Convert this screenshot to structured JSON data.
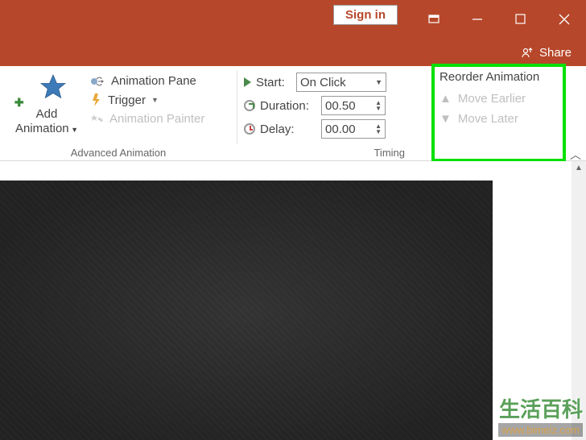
{
  "titlebar": {
    "signin": "Sign in"
  },
  "sharebar": {
    "share": "Share"
  },
  "ribbon": {
    "add_animation": {
      "line1": "Add",
      "line2": "Animation"
    },
    "advanced": {
      "pane": "Animation Pane",
      "trigger": "Trigger",
      "painter": "Animation Painter",
      "group_title": "Advanced Animation"
    },
    "timing": {
      "start_label": "Start:",
      "start_value": "On Click",
      "duration_label": "Duration:",
      "duration_value": "00.50",
      "delay_label": "Delay:",
      "delay_value": "00.00",
      "group_title": "Timing"
    },
    "reorder": {
      "title": "Reorder Animation",
      "earlier": "Move Earlier",
      "later": "Move Later"
    }
  },
  "watermark": {
    "line1": "生活百科",
    "line2": "www.bimeiz.com"
  }
}
